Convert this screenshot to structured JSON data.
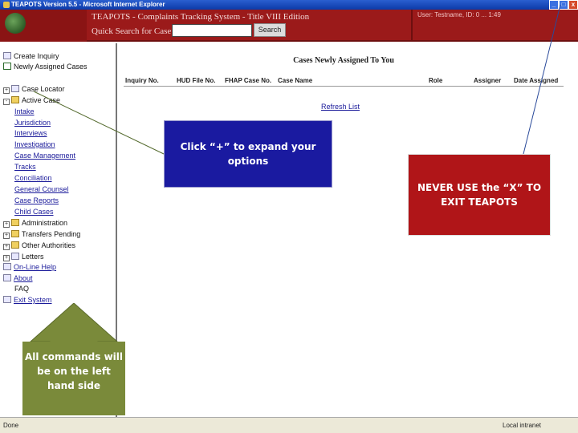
{
  "window": {
    "title": "TEAPOTS Version 5.5 - Microsoft Internet Explorer",
    "minimize": "_",
    "maximize": "□",
    "close": "x"
  },
  "header": {
    "app_title": "TEAPOTS - Complaints Tracking System - Title VIII Edition",
    "search_label": "Quick Search for Case",
    "search_value": "",
    "search_button": "Search",
    "user_info": "User: Testname, ID: 0 ... 1:49"
  },
  "nav": {
    "items": [
      {
        "label": "Create Inquiry",
        "icon": "document-icon"
      },
      {
        "label": "Newly Assigned Cases",
        "icon": "checkbox-icon"
      },
      {
        "label": "Case Locator",
        "icon": "magnifier-icon",
        "toggle": "+"
      },
      {
        "label": "Active Case",
        "icon": "folder-icon",
        "toggle": "-"
      },
      {
        "label": "Intake"
      },
      {
        "label": "Jurisdiction"
      },
      {
        "label": "Interviews"
      },
      {
        "label": "Investigation"
      },
      {
        "label": "Case Management"
      },
      {
        "label": "Tracks"
      },
      {
        "label": "Conciliation"
      },
      {
        "label": "General Counsel"
      },
      {
        "label": "Case Reports"
      },
      {
        "label": "Child Cases"
      },
      {
        "label": "Administration",
        "icon": "folder-icon",
        "toggle": "+"
      },
      {
        "label": "Transfers Pending",
        "icon": "folder-icon",
        "toggle": "+"
      },
      {
        "label": "Other Authorities",
        "icon": "folder-icon",
        "toggle": "+"
      },
      {
        "label": "Letters",
        "icon": "document-icon",
        "toggle": "+"
      },
      {
        "label": "On-Line Help",
        "icon": "help-icon"
      },
      {
        "label": "About",
        "icon": "info-icon"
      },
      {
        "label": "FAQ"
      },
      {
        "label": "Exit System",
        "icon": "exit-icon"
      }
    ]
  },
  "main": {
    "title": "Cases Newly Assigned To You",
    "columns": [
      "Inquiry No.",
      "HUD File No.",
      "FHAP Case No.",
      "Case Name",
      "Role",
      "Assigner",
      "Date Assigned"
    ],
    "refresh_link": "Refresh List"
  },
  "status": {
    "left": "Done",
    "right": "Local intranet"
  },
  "callouts": {
    "expand": "Click “+” to expand your options",
    "exit_warning": "NEVER USE the “X” TO EXIT TEAPOTS",
    "commands": "All commands will be on the left hand side"
  },
  "colors": {
    "header_red": "#9b1a1a",
    "callout_blue": "#1a1aa0",
    "callout_red": "#b01518",
    "arrow_green": "#7a8a3a"
  }
}
